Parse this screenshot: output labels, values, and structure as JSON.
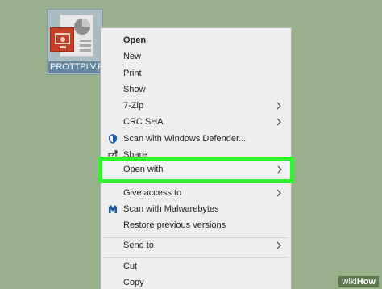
{
  "desktop": {
    "file_name": "PROTTPLV.PP",
    "file_icon": "powerpoint-file-icon"
  },
  "menu": {
    "items": [
      {
        "label": "Open",
        "bold": true
      },
      {
        "label": "New"
      },
      {
        "label": "Print"
      },
      {
        "label": "Show"
      },
      {
        "label": "7-Zip",
        "submenu": true
      },
      {
        "label": "CRC SHA",
        "submenu": true
      },
      {
        "label": "Scan with Windows Defender...",
        "icon": "defender-shield-icon"
      },
      {
        "label": "Share",
        "icon": "share-icon"
      },
      {
        "label": "Open with",
        "submenu": true,
        "highlighted": true
      },
      {
        "label": "Give access to",
        "submenu": true
      },
      {
        "label": "Scan with Malwarebytes",
        "icon": "malwarebytes-icon"
      },
      {
        "label": "Restore previous versions"
      },
      {
        "label": "Send to",
        "submenu": true
      },
      {
        "label": "Cut"
      },
      {
        "label": "Copy"
      }
    ]
  },
  "colors": {
    "desktop_bg": "#98b08c",
    "highlight_border": "#2ef52e",
    "menu_bg": "#eeeeee"
  },
  "watermark": {
    "part1": "wiki",
    "part2": "How"
  }
}
